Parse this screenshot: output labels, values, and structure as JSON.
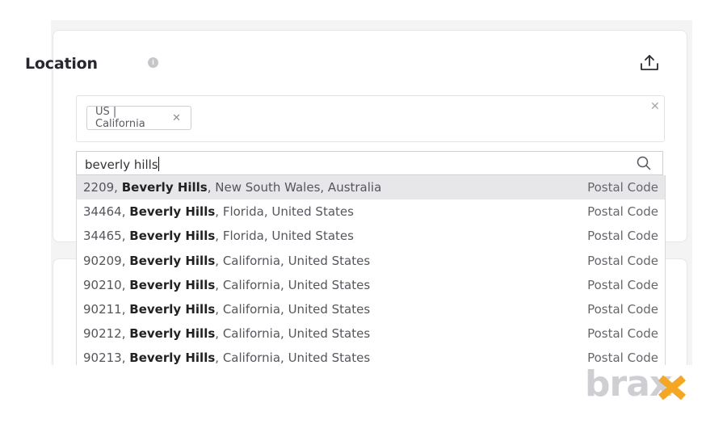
{
  "section": {
    "title": "Location",
    "info_icon": "info-icon",
    "upload_icon": "upload-icon"
  },
  "chips": [
    {
      "label": "US | California",
      "remove_icon": "close-icon"
    }
  ],
  "clear_icon": "close-icon",
  "search": {
    "value": "beverly hills",
    "icon": "search-icon"
  },
  "results": [
    {
      "prefix": "2209, ",
      "match": "Beverly Hills",
      "suffix": ", New South Wales, Australia",
      "type": "Postal Code",
      "highlighted": true
    },
    {
      "prefix": "34464, ",
      "match": "Beverly Hills",
      "suffix": ", Florida, United States",
      "type": "Postal Code"
    },
    {
      "prefix": "34465, ",
      "match": "Beverly Hills",
      "suffix": ", Florida, United States",
      "type": "Postal Code"
    },
    {
      "prefix": "90209, ",
      "match": "Beverly Hills",
      "suffix": ", California, United States",
      "type": "Postal Code"
    },
    {
      "prefix": "90210, ",
      "match": "Beverly Hills",
      "suffix": ", California, United States",
      "type": "Postal Code"
    },
    {
      "prefix": "90211, ",
      "match": "Beverly Hills",
      "suffix": ", California, United States",
      "type": "Postal Code"
    },
    {
      "prefix": "90212, ",
      "match": "Beverly Hills",
      "suffix": ", California, United States",
      "type": "Postal Code"
    },
    {
      "prefix": "90213, ",
      "match": "Beverly Hills",
      "suffix": ", California, United States",
      "type": "Postal Code"
    }
  ],
  "watermark": {
    "text": "brax",
    "colors": {
      "main": "#cfcfd3",
      "accent": "#f5a623"
    }
  }
}
